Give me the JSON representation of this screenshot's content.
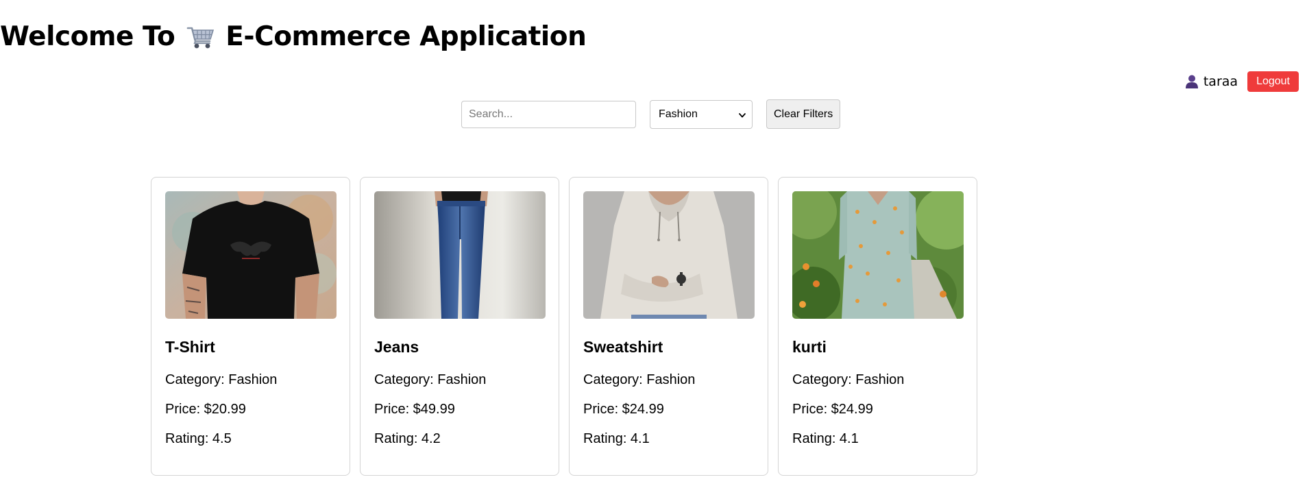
{
  "header": {
    "title_prefix": "Welcome To",
    "title_suffix": "E-Commerce Application",
    "cart_icon": "shopping-cart-icon"
  },
  "user": {
    "icon": "user-icon",
    "name": "taraa",
    "logout_label": "Logout",
    "logout_color": "#ef3b3b"
  },
  "filters": {
    "search_placeholder": "Search...",
    "search_value": "",
    "category_selected": "Fashion",
    "clear_label": "Clear Filters"
  },
  "products": [
    {
      "name": "T-Shirt",
      "category": "Category: Fashion",
      "price": "Price: $20.99",
      "rating": "Rating: 4.5",
      "image": "black-tshirt-photo"
    },
    {
      "name": "Jeans",
      "category": "Category: Fashion",
      "price": "Price: $49.99",
      "rating": "Rating: 4.2",
      "image": "blue-jeans-photo"
    },
    {
      "name": "Sweatshirt",
      "category": "Category: Fashion",
      "price": "Price: $24.99",
      "rating": "Rating: 4.1",
      "image": "beige-hoodie-photo"
    },
    {
      "name": "kurti",
      "category": "Category: Fashion",
      "price": "Price: $24.99",
      "rating": "Rating: 4.1",
      "image": "floral-kurti-photo"
    }
  ]
}
